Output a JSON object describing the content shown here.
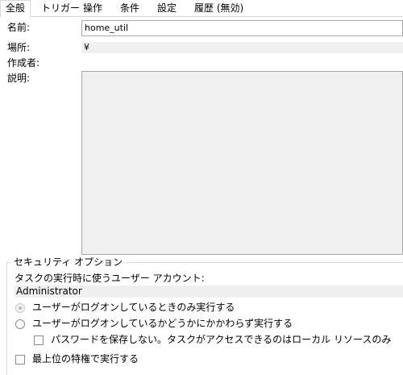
{
  "tabs": [
    {
      "label": "全般",
      "active": true
    },
    {
      "label": "トリガー"
    },
    {
      "label": "操作"
    },
    {
      "label": "条件"
    },
    {
      "label": "設定"
    },
    {
      "label": "履歴 (無効)"
    }
  ],
  "general": {
    "name_label": "名前:",
    "name_value": "home_util",
    "location_label": "場所:",
    "location_value": "¥",
    "author_label": "作成者:",
    "author_value": "",
    "description_label": "説明:",
    "description_value": ""
  },
  "security": {
    "group_title": "セキュリティ オプション",
    "account_prompt": "タスクの実行時に使うユーザー アカウント:",
    "account_value": "Administrator",
    "radio_logged_on": "ユーザーがログオンしているときのみ実行する",
    "radio_whether_logged_on": "ユーザーがログオンしているかどうかにかかわらず実行する",
    "do_not_store_password": "パスワードを保存しない。タスクがアクセスできるのはローカル リソースのみ",
    "highest_privileges": "最上位の特権で実行する"
  }
}
